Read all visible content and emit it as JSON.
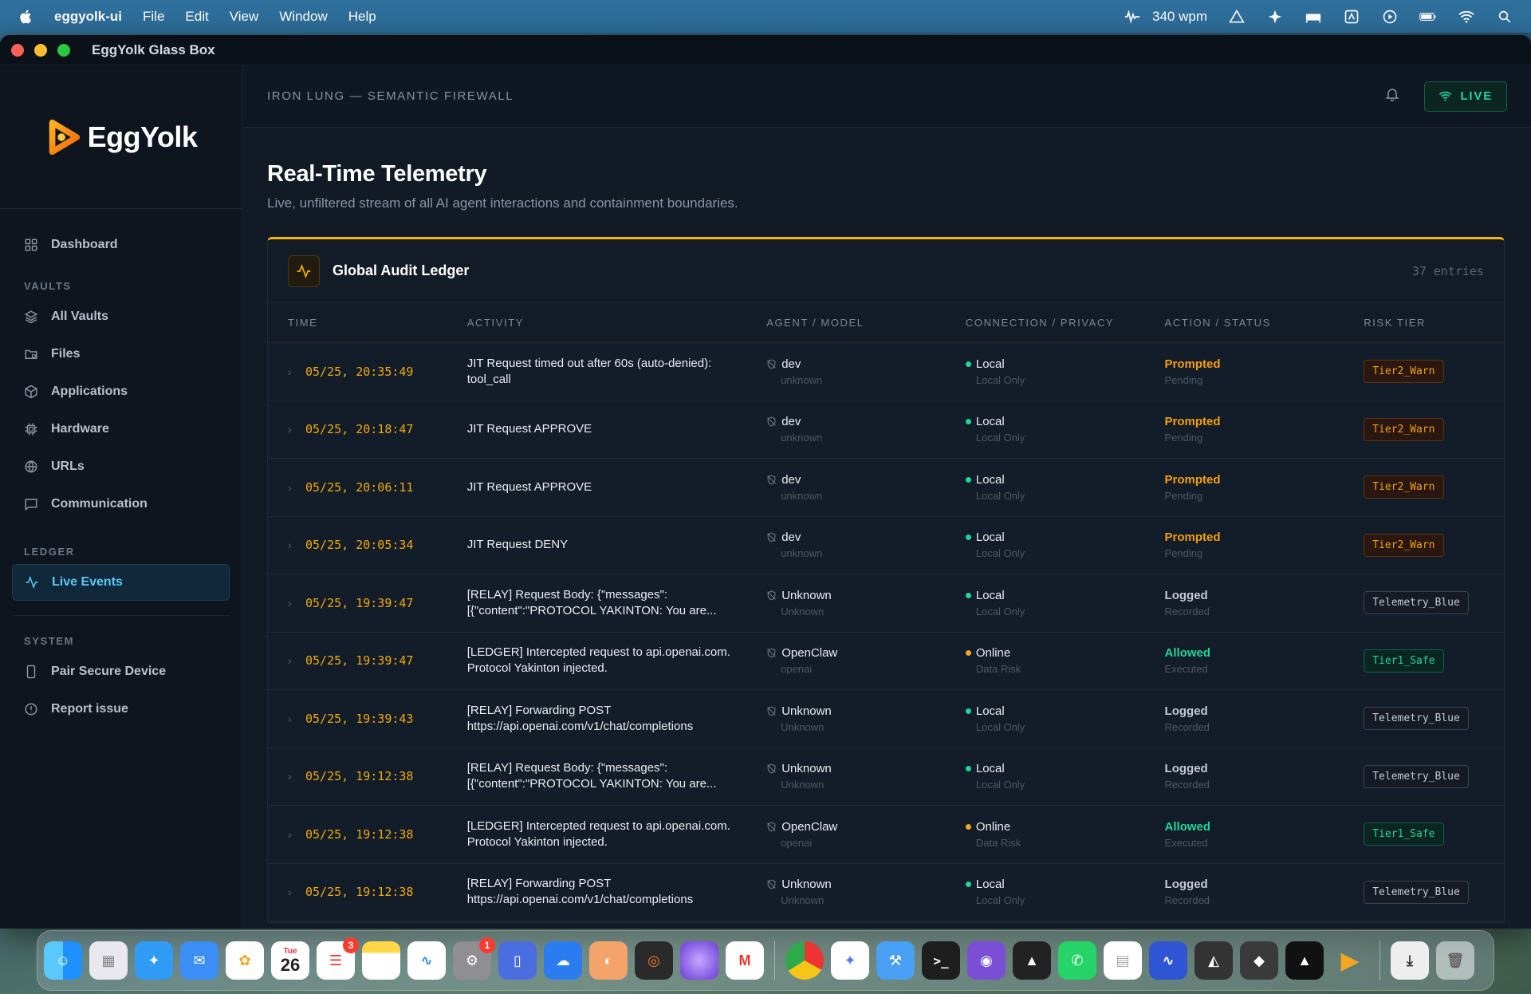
{
  "menubar": {
    "app_name": "eggyolk-ui",
    "items": [
      "File",
      "Edit",
      "View",
      "Window",
      "Help"
    ],
    "wpm": "340 wpm"
  },
  "window": {
    "title": "EggYolk Glass Box"
  },
  "sidebar": {
    "logo": "EggYolk",
    "dashboard": "Dashboard",
    "vaults_label": "VAULTS",
    "vaults": [
      "All Vaults",
      "Files",
      "Applications",
      "Hardware",
      "URLs",
      "Communication"
    ],
    "ledger_label": "LEDGER",
    "live_events": "Live Events",
    "system_label": "SYSTEM",
    "system": [
      "Pair Secure Device",
      "Report issue"
    ]
  },
  "topbar": {
    "breadcrumb": "IRON LUNG — SEMANTIC FIREWALL",
    "live_label": "LIVE"
  },
  "page": {
    "title": "Real-Time Telemetry",
    "subtitle": "Live, unfiltered stream of all AI agent interactions and containment boundaries."
  },
  "ledger": {
    "title": "Global Audit Ledger",
    "count": "37 entries",
    "columns": [
      "TIME",
      "ACTIVITY",
      "AGENT / MODEL",
      "CONNECTION / PRIVACY",
      "ACTION / STATUS",
      "RISK TIER"
    ],
    "rows": [
      {
        "time": "05/25, 20:35:49",
        "activity": "JIT Request timed out after 60s (auto-denied):\ntool_call",
        "agent": "dev",
        "model": "unknown",
        "conn": "Local",
        "privacy": "Local Only",
        "action": "Prompted",
        "status": "Pending",
        "tier": "Tier2_Warn"
      },
      {
        "time": "05/25, 20:18:47",
        "activity": "JIT Request APPROVE",
        "agent": "dev",
        "model": "unknown",
        "conn": "Local",
        "privacy": "Local Only",
        "action": "Prompted",
        "status": "Pending",
        "tier": "Tier2_Warn"
      },
      {
        "time": "05/25, 20:06:11",
        "activity": "JIT Request APPROVE",
        "agent": "dev",
        "model": "unknown",
        "conn": "Local",
        "privacy": "Local Only",
        "action": "Prompted",
        "status": "Pending",
        "tier": "Tier2_Warn"
      },
      {
        "time": "05/25, 20:05:34",
        "activity": "JIT Request DENY",
        "agent": "dev",
        "model": "unknown",
        "conn": "Local",
        "privacy": "Local Only",
        "action": "Prompted",
        "status": "Pending",
        "tier": "Tier2_Warn"
      },
      {
        "time": "05/25, 19:39:47",
        "activity": "[RELAY] Request Body: {\"messages\":\n[{\"content\":\"PROTOCOL YAKINTON: You are...",
        "agent": "Unknown",
        "model": "Unknown",
        "conn": "Local",
        "privacy": "Local Only",
        "action": "Logged",
        "status": "Recorded",
        "tier": "Telemetry_Blue"
      },
      {
        "time": "05/25, 19:39:47",
        "activity": "[LEDGER] Intercepted request to api.openai.com.\nProtocol Yakinton injected.",
        "agent": "OpenClaw",
        "model": "openai",
        "conn": "Online",
        "privacy": "Data Risk",
        "action": "Allowed",
        "status": "Executed",
        "tier": "Tier1_Safe"
      },
      {
        "time": "05/25, 19:39:43",
        "activity": "[RELAY] Forwarding POST\nhttps://api.openai.com/v1/chat/completions",
        "agent": "Unknown",
        "model": "Unknown",
        "conn": "Local",
        "privacy": "Local Only",
        "action": "Logged",
        "status": "Recorded",
        "tier": "Telemetry_Blue"
      },
      {
        "time": "05/25, 19:12:38",
        "activity": "[RELAY] Request Body: {\"messages\":\n[{\"content\":\"PROTOCOL YAKINTON: You are...",
        "agent": "Unknown",
        "model": "Unknown",
        "conn": "Local",
        "privacy": "Local Only",
        "action": "Logged",
        "status": "Recorded",
        "tier": "Telemetry_Blue"
      },
      {
        "time": "05/25, 19:12:38",
        "activity": "[LEDGER] Intercepted request to api.openai.com.\nProtocol Yakinton injected.",
        "agent": "OpenClaw",
        "model": "openai",
        "conn": "Online",
        "privacy": "Data Risk",
        "action": "Allowed",
        "status": "Executed",
        "tier": "Tier1_Safe"
      },
      {
        "time": "05/25, 19:12:38",
        "activity": "[RELAY] Forwarding POST\nhttps://api.openai.com/v1/chat/completions",
        "agent": "Unknown",
        "model": "Unknown",
        "conn": "Local",
        "privacy": "Local Only",
        "action": "Logged",
        "status": "Recorded",
        "tier": "Telemetry_Blue"
      }
    ]
  },
  "colors": {
    "accent_yellow": "#f5b400",
    "warn": "#f59e0b",
    "safe": "#1fd69a",
    "local_dot": "#1fd69a",
    "online_dot": "#f5a623",
    "sidebar_active": "#5ec8f5"
  },
  "dock": {
    "calendar_day": "Tue",
    "calendar_date": "26",
    "reminders_badge": "3",
    "settings_badge": "1"
  }
}
